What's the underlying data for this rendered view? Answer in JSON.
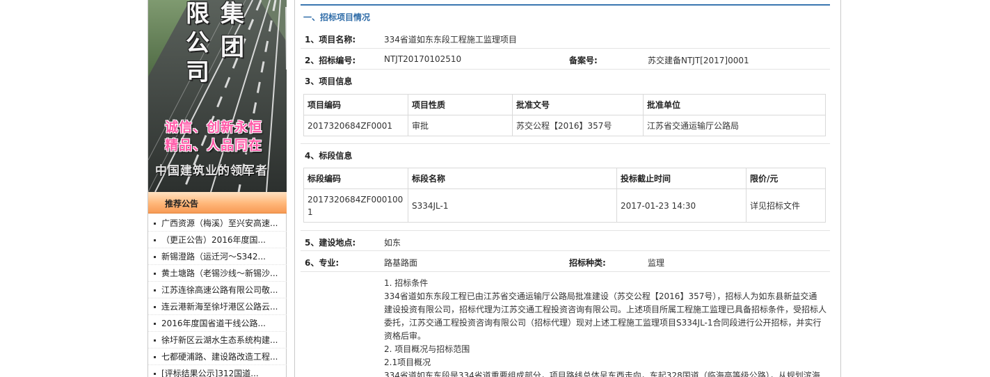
{
  "banner": {
    "big_chars_left": [
      "限",
      "公",
      "司"
    ],
    "big_chars_right": [
      "集",
      "团"
    ],
    "slogan_line1": "诚信、创新永恒",
    "slogan_line2": "精品、人品同在",
    "tagline": "中国建筑业的领军者"
  },
  "recommend": {
    "title": "推荐公告",
    "items": [
      "广西资源（梅溪）至兴安高速...",
      "（更正公告）2016年度国...",
      "新锡澄路（运迁河～S342...",
      "黄土塘路（老锡沙线～新锡沙...",
      "江苏连徐高速公路有限公司敬...",
      "连云港新海至徐圩港区公路云...",
      "2016年度国省道干线公路...",
      "徐圩新区云湖水生态系统构建...",
      "七都硬浦路、建设路改造工程...",
      "[评标结果公示]312国道..."
    ]
  },
  "section": {
    "title": "一、招标项目情况"
  },
  "fields": {
    "project_name_label": "1、项目名称:",
    "project_name": "334省道如东东段工程施工监理项目",
    "tender_no_label": "2、招标编号:",
    "tender_no": "NTJT20170102510",
    "record_no_label": "备案号:",
    "record_no": "苏交建备NTJT[2017]0001",
    "project_info_label": "3、项目信息",
    "lot_info_label": "4、标段信息",
    "location_label": "5、建设地点:",
    "location": "如东",
    "specialty_label": "6、专业:",
    "specialty": "路基路面",
    "tender_type_label": "招标种类:",
    "tender_type": "监理"
  },
  "project_table": {
    "headers": [
      "项目编码",
      "项目性质",
      "批准文号",
      "批准单位"
    ],
    "rows": [
      [
        "2017320684ZF0001",
        "审批",
        "苏交公程【2016】357号",
        "江苏省交通运输厅公路局"
      ]
    ]
  },
  "lot_table": {
    "headers": [
      "标段编码",
      "标段名称",
      "投标截止时间",
      "限价/元"
    ],
    "rows": [
      [
        "2017320684ZF0001001",
        "S334JL-1",
        "2017-01-23 14:30",
        "详见招标文件"
      ]
    ]
  },
  "body": {
    "h1": "1. 招标条件",
    "p1_lines": [
      "334省道如东东段工程已由江苏省交通运输厅公路局批准建设（苏交公程【2016】357号），招标人为如东县新益交通",
      "建设投资有限公司，招标代理为江苏交通工程投资咨询有限公司。上述项目所属工程施工监理已具备招标条件，受招标人",
      "委托，江苏交通工程投资咨询有限公司（招标代理）现对上述工程施工监理项目S334JL-1合同段进行公开招标，并实行",
      "资格后审。"
    ],
    "h2": "2. 项目概况与招标范围",
    "h3": "2.1项目概况",
    "p2": "334省道如东东段是334省道重要组成部分，项目路线总体呈东西走向，东起328国道（临海高等级公路），从规划滨海"
  }
}
